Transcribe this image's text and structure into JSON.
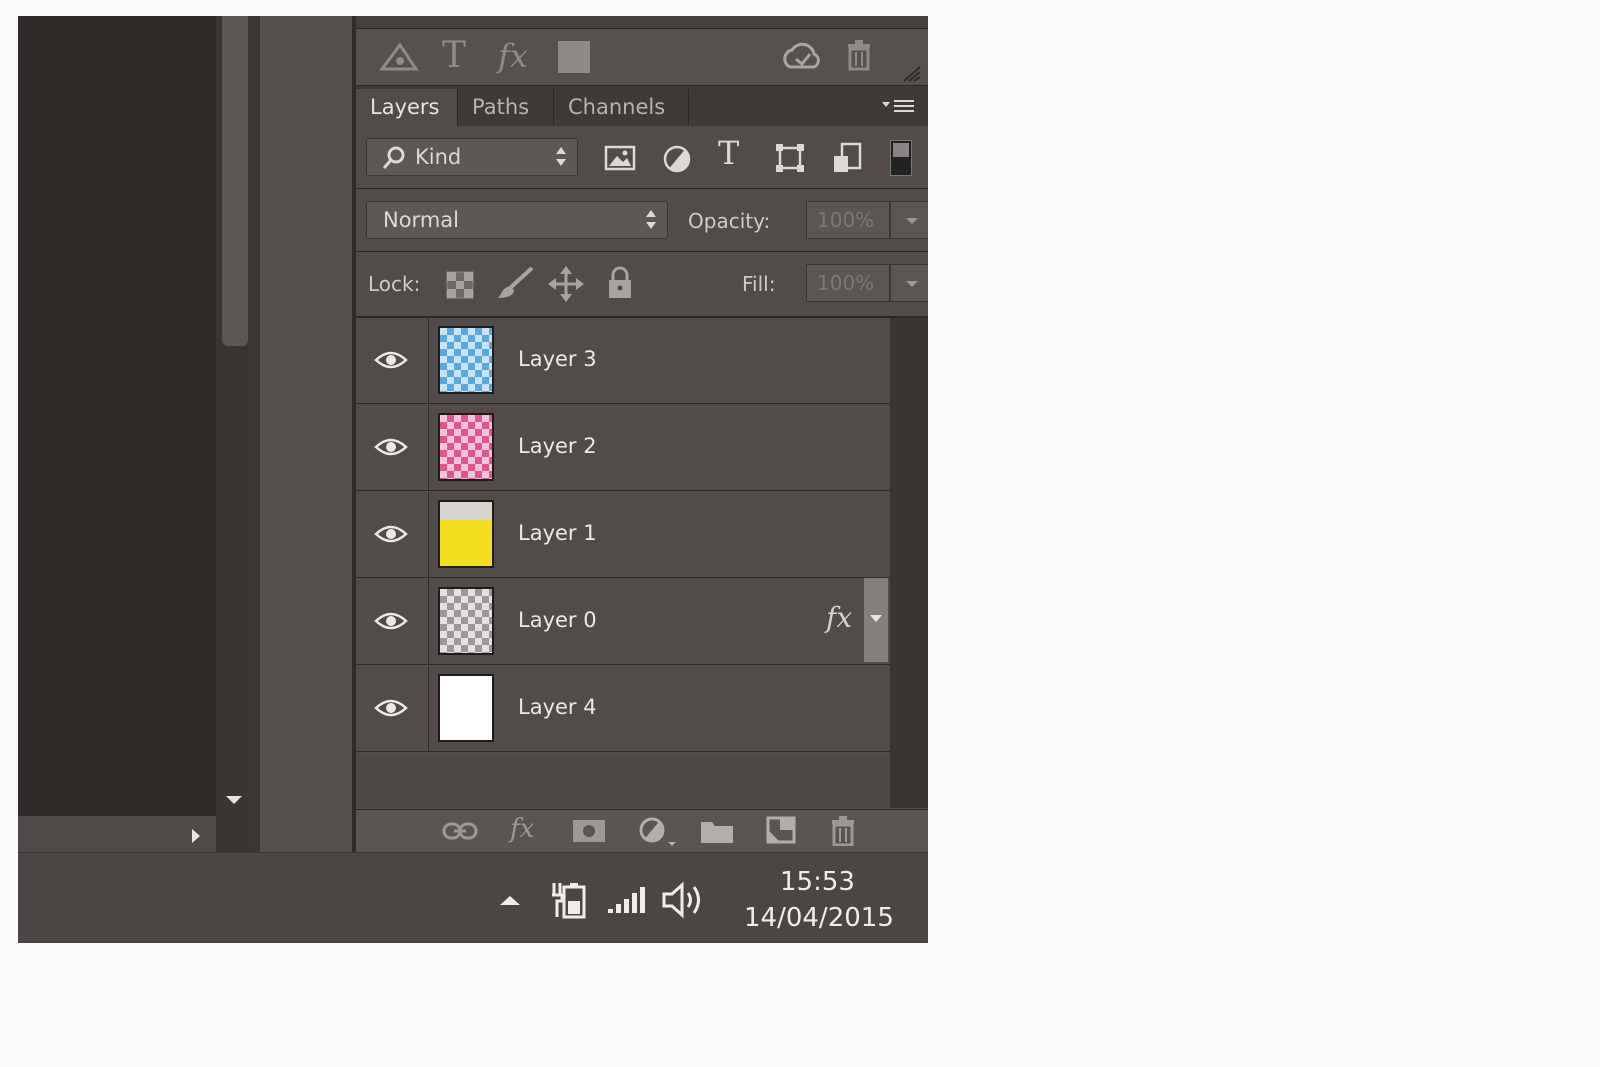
{
  "colors": {
    "panel_bg": "#514b49",
    "tab_bar_bg": "#3f3a38",
    "canvas_bg": "#2e2a28",
    "taskbar_bg": "#4b4644",
    "layer3_thumb": "#5aa9dc",
    "layer2_thumb": "#e0558f",
    "layer1_thumb": "#f2dd1e",
    "layer4_thumb": "#ffffff"
  },
  "toolbar_top": {
    "icons": [
      "pen-path-icon",
      "type-icon",
      "fx-icon",
      "color-swatch-icon",
      "cloud-sync-icon",
      "trash-icon"
    ],
    "type_glyph": "T",
    "fx_glyph": "fx"
  },
  "tabs": [
    {
      "label": "Layers",
      "active": true
    },
    {
      "label": "Paths",
      "active": false
    },
    {
      "label": "Channels",
      "active": false
    }
  ],
  "filter": {
    "kind_label": "Kind",
    "type_glyph": "T",
    "icons": [
      "image-filter-icon",
      "adjustment-filter-icon",
      "type-filter-icon",
      "shape-filter-icon",
      "smart-object-filter-icon",
      "filter-toggle-icon"
    ]
  },
  "blend": {
    "mode": "Normal",
    "opacity_label": "Opacity:",
    "opacity_value": "100%"
  },
  "lock": {
    "label": "Lock:",
    "icons": [
      "lock-transparent-icon",
      "lock-paint-icon",
      "lock-position-icon",
      "lock-all-icon"
    ],
    "fill_label": "Fill:",
    "fill_value": "100%"
  },
  "layers": [
    {
      "name": "Layer 3",
      "thumb": "blue-checker",
      "fx": false
    },
    {
      "name": "Layer 2",
      "thumb": "pink-checker",
      "fx": false
    },
    {
      "name": "Layer 1",
      "thumb": "yellow-checker",
      "fx": false
    },
    {
      "name": "Layer 0",
      "thumb": "gray-checker",
      "fx": true,
      "fx_label": "fx"
    },
    {
      "name": "Layer 4",
      "thumb": "white",
      "fx": false
    }
  ],
  "bottom_bar": {
    "icons": [
      "link-layers-icon",
      "add-style-icon",
      "add-mask-icon",
      "new-adjustment-icon",
      "new-group-icon",
      "new-layer-icon",
      "delete-layer-icon"
    ],
    "fx_glyph": "fx"
  },
  "taskbar": {
    "icons": [
      "show-hidden-icons-icon",
      "battery-icon",
      "signal-icon",
      "volume-icon"
    ],
    "time": "15:53",
    "date": "14/04/2015"
  }
}
